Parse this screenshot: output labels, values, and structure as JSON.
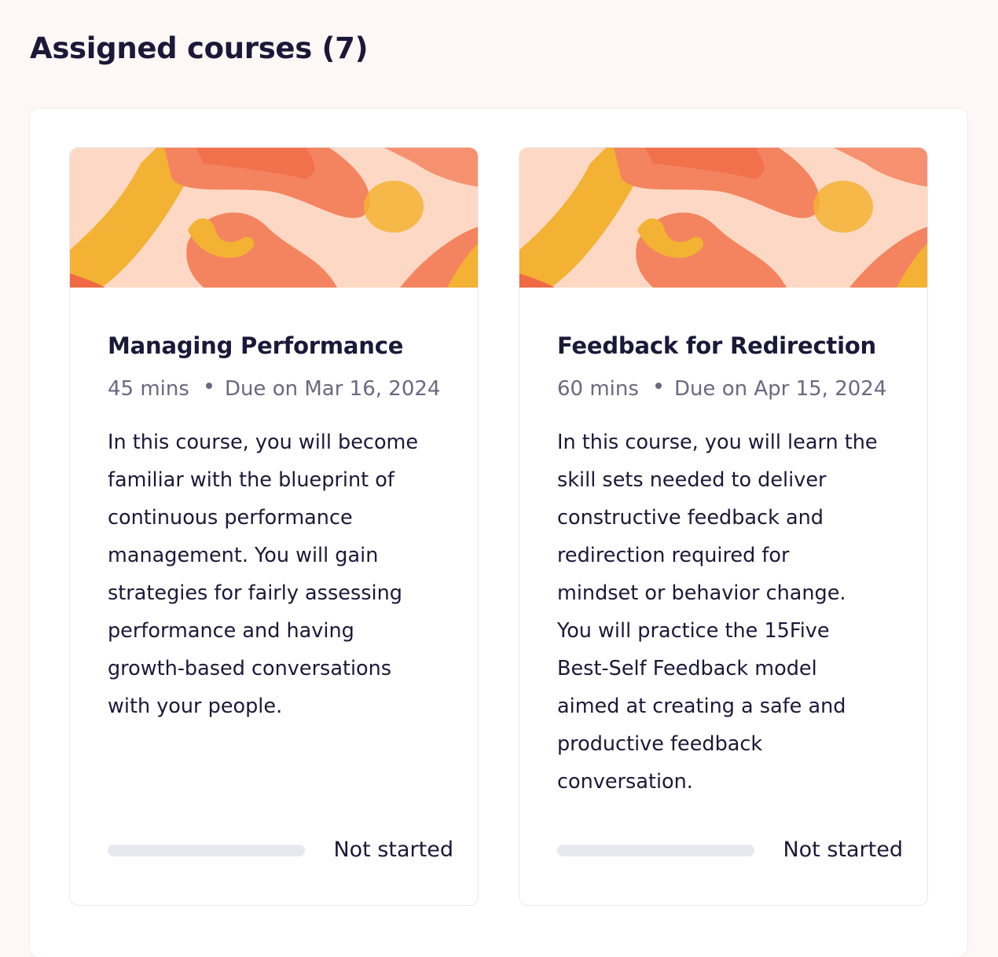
{
  "header": {
    "title": "Assigned courses (7)"
  },
  "colors": {
    "background": "#fdf8f6",
    "card": "#ffffff",
    "text_primary": "#1c1838",
    "text_secondary": "#6b6880",
    "progress_track": "#e8e8ef",
    "banner_peach": "#fdd9c5",
    "banner_coral": "#f4845f",
    "banner_yellow": "#f3b233"
  },
  "courses": [
    {
      "title": "Managing Performance",
      "duration": "45 mins",
      "due": "Due on Mar 16, 2024",
      "description_lines": [
        "In this course, you will become",
        "familiar with the blueprint of",
        "continuous performance",
        "management. You will gain",
        "strategies for fairly assessing",
        "performance and having",
        "growth-based conversations",
        "with your people."
      ],
      "progress": 0,
      "status": "Not started"
    },
    {
      "title": "Feedback for Redirection",
      "duration": "60 mins",
      "due": "Due on Apr 15, 2024",
      "description_lines": [
        "In this course, you will learn the",
        "skill sets needed to deliver",
        "constructive feedback and",
        "redirection required for",
        "mindset or behavior change.",
        "You will practice the 15Five",
        "Best-Self Feedback model",
        "aimed at creating a safe and",
        "productive feedback",
        "conversation."
      ],
      "progress": 0,
      "status": "Not started"
    }
  ]
}
